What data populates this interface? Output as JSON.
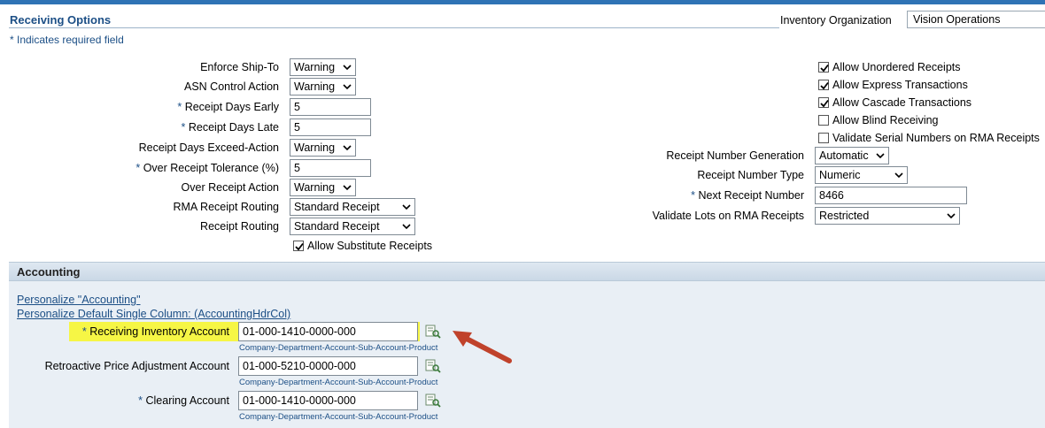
{
  "header": {
    "title": "Receiving Options",
    "required_note": "* Indicates required field",
    "org_label": "Inventory Organization",
    "org_value": "Vision Operations"
  },
  "left_fields": {
    "enforce_ship_to": {
      "label": "Enforce Ship-To",
      "value": "Warning"
    },
    "asn_control": {
      "label": "ASN Control Action",
      "value": "Warning"
    },
    "days_early": {
      "label": "Receipt Days Early",
      "value": "5"
    },
    "days_late": {
      "label": "Receipt Days Late",
      "value": "5"
    },
    "days_exceed": {
      "label": "Receipt Days Exceed-Action",
      "value": "Warning"
    },
    "over_tolerance": {
      "label": "Over Receipt Tolerance (%)",
      "value": "5"
    },
    "over_action": {
      "label": "Over Receipt Action",
      "value": "Warning"
    },
    "rma_routing": {
      "label": "RMA Receipt Routing",
      "value": "Standard Receipt"
    },
    "receipt_routing": {
      "label": "Receipt Routing",
      "value": "Standard Receipt"
    },
    "allow_substitute": {
      "label": "Allow Substitute Receipts",
      "checked": true
    }
  },
  "right_checks": [
    {
      "label": "Allow Unordered Receipts",
      "checked": true
    },
    {
      "label": "Allow Express Transactions",
      "checked": true
    },
    {
      "label": "Allow Cascade Transactions",
      "checked": true
    },
    {
      "label": "Allow Blind Receiving",
      "checked": false
    },
    {
      "label": "Validate Serial Numbers on RMA Receipts",
      "checked": false
    }
  ],
  "right_fields": {
    "number_generation": {
      "label": "Receipt Number Generation",
      "value": "Automatic"
    },
    "number_type": {
      "label": "Receipt Number Type",
      "value": "Numeric"
    },
    "next_number": {
      "label": "Next Receipt Number",
      "value": "8466"
    },
    "validate_lots": {
      "label": "Validate Lots on RMA Receipts",
      "value": "Restricted"
    }
  },
  "accounting": {
    "title": "Accounting",
    "personalize_link": "Personalize \"Accounting\"",
    "personalize_column_link": "Personalize Default Single Column: (AccountingHdrCol)",
    "receiving_inventory": {
      "label": "Receiving Inventory Account",
      "value": "01-000-1410-0000-000"
    },
    "retroactive": {
      "label": "Retroactive Price Adjustment Account",
      "value": "01-000-5210-0000-000"
    },
    "clearing": {
      "label": "Clearing Account",
      "value": "01-000-1410-0000-000"
    },
    "segment_hint": "Company-Department-Account-Sub-Account-Product"
  },
  "colors": {
    "accent": "#2f73b5",
    "highlight": "#f6f645",
    "arrow": "#c0422b"
  },
  "required_star": "*"
}
